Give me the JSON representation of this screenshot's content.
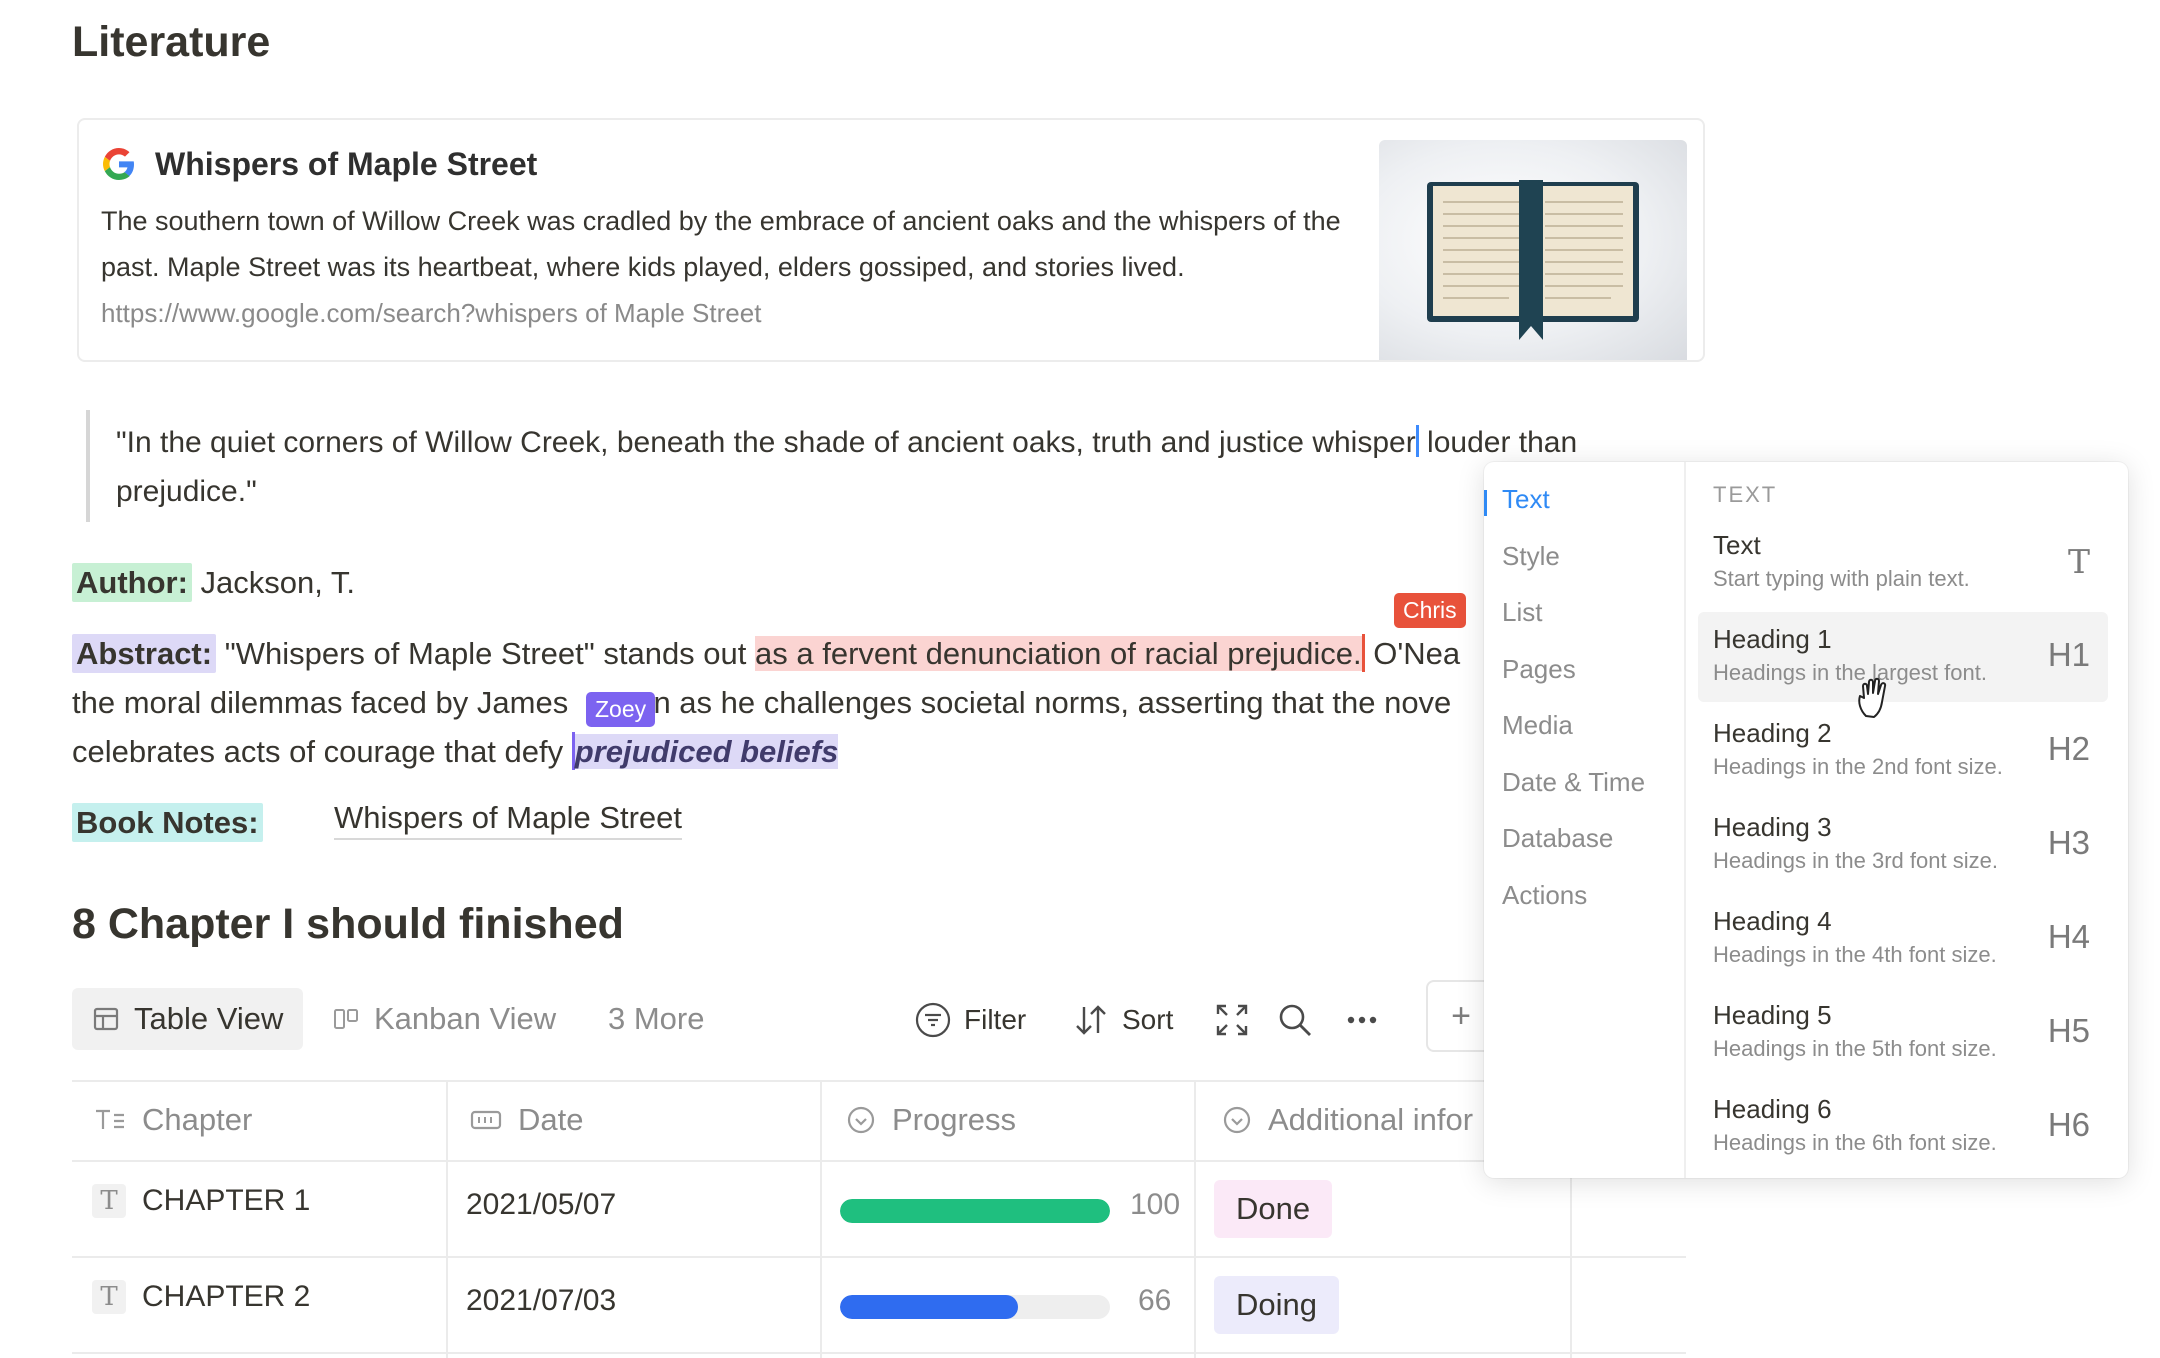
{
  "page": {
    "title": "Literature"
  },
  "bookmark": {
    "title": "Whispers of Maple Street",
    "description": "The southern town of Willow Creek was cradled by the embrace of ancient oaks and the whispers of the past. Maple Street was its heartbeat, where kids played, elders gossiped, and stories lived.",
    "url": "https://www.google.com/search?whispers of Maple Street",
    "icon": "google-logo-icon"
  },
  "quote": {
    "before_cursor": "\"In the quiet corners of Willow Creek, beneath the shade of ancient oaks, truth and justice whisper",
    "after_cursor": " louder than prejudice.\""
  },
  "author": {
    "label": "Author:",
    "value": " Jackson, T."
  },
  "abstract": {
    "label": "Abstract:",
    "part1": " \"Whispers of Maple Street\" stands out ",
    "highlight_red": "as a fervent denunciation of racial prejudice.",
    "part2": " O'Nea",
    "line2a": "the moral dilemmas faced by James",
    "line2b": "on as he challenges societal norms, asserting that the nove",
    "line3": "celebrates acts of courage that defy ",
    "highlight_purple": "prejudiced beliefs"
  },
  "collaborators": {
    "chris": "Chris",
    "zoey": "Zoey",
    "chris_color": "#e8523b",
    "zoey_color": "#7c63f0"
  },
  "book_notes": {
    "label": "Book Notes:",
    "value": "Whispers of Maple Street"
  },
  "section": {
    "title": "8 Chapter I should finished"
  },
  "views": {
    "table": "Table View",
    "kanban": "Kanban View",
    "more": "3 More",
    "filter": "Filter",
    "sort": "Sort",
    "add": "+"
  },
  "table": {
    "headers": {
      "chapter": "Chapter",
      "date": "Date",
      "progress": "Progress",
      "additional": "Additional infor"
    },
    "rows": [
      {
        "chapter": "CHAPTER 1",
        "date": "2021/05/07",
        "progress": 100,
        "progress_label": "100",
        "status": "Done",
        "bar_color": "#1fbf7f",
        "status_bg": "#fbe9f7"
      },
      {
        "chapter": "CHAPTER 2",
        "date": "2021/07/03",
        "progress": 66,
        "progress_label": "66",
        "status": "Doing",
        "bar_color": "#2f6cf0",
        "status_bg": "#ecebfb"
      }
    ]
  },
  "menu": {
    "categories": [
      "Text",
      "Style",
      "List",
      "Pages",
      "Media",
      "Date & Time",
      "Database",
      "Actions"
    ],
    "active_category": "Text",
    "section_header": "TEXT",
    "items": [
      {
        "title": "Text",
        "desc": "Start typing with plain text.",
        "shortcut": "T"
      },
      {
        "title": "Heading 1",
        "desc": "Headings in the largest font.",
        "shortcut": "H1"
      },
      {
        "title": "Heading 2",
        "desc": "Headings in the 2nd font size.",
        "shortcut": "H2"
      },
      {
        "title": "Heading 3",
        "desc": "Headings in the 3rd font size.",
        "shortcut": "H3"
      },
      {
        "title": "Heading 4",
        "desc": "Headings in the 4th font size.",
        "shortcut": "H4"
      },
      {
        "title": "Heading 5",
        "desc": "Headings in the 5th font size.",
        "shortcut": "H5"
      },
      {
        "title": "Heading 6",
        "desc": "Headings in the 6th font size.",
        "shortcut": "H6"
      }
    ],
    "hovered_item": "Heading 1"
  }
}
